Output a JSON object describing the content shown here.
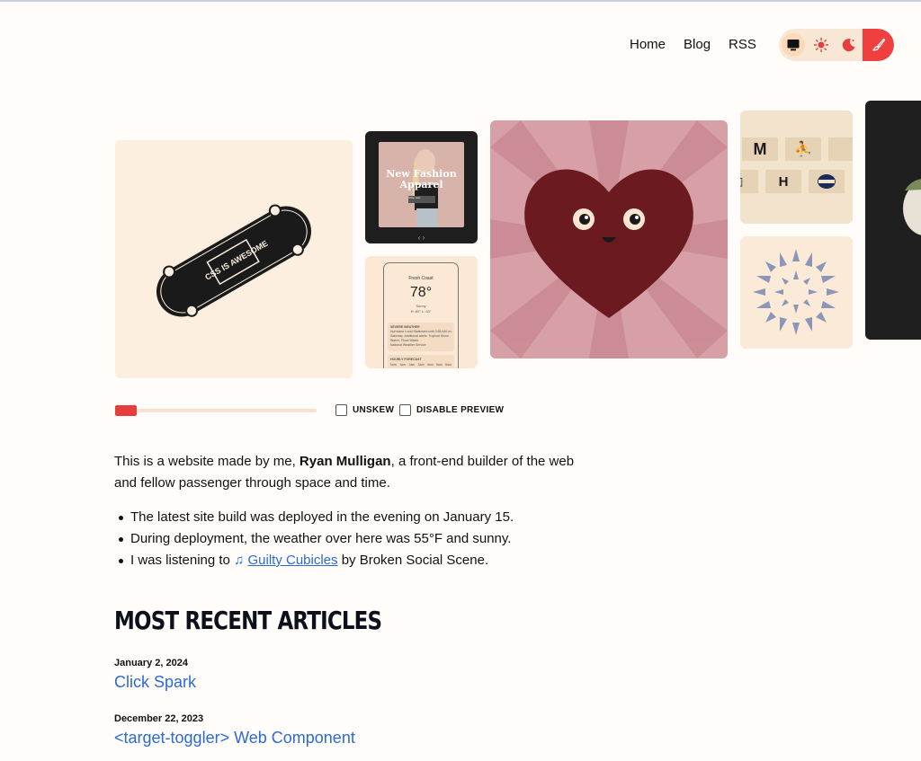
{
  "nav": {
    "home": "Home",
    "blog": "Blog",
    "rss": "RSS"
  },
  "theme_switcher": {
    "options": [
      "monitor-icon",
      "sun-icon",
      "moon-icon",
      "brush-icon"
    ],
    "active": "monitor-icon"
  },
  "gallery": {
    "skateboard_text": "CSS IS AWESOME",
    "fashion_title": "New Fashion Apparel",
    "fashion_button": "Shop now",
    "weather_city": "Fresh Coast",
    "weather_temp": "78°",
    "weather_cond": "Sunny",
    "weather_hilo": "H: 80° L: 63°",
    "weather_alert_title": "SEVERE WEATHER",
    "weather_alert_text": "Hurricane Local Statement until 3:55 AM on Saturday. Additional alerts: Tropical Storm Watch, Flood Watch.",
    "weather_source": "National Weather Service",
    "weather_forecast_title": "HOURLY FORECAST",
    "weather_forecast_days": [
      "Now",
      "1am",
      "2am",
      "3am",
      "4am",
      "5am",
      "6am"
    ]
  },
  "controls": {
    "slider_value": 0,
    "unskew_label": "UNSKEW",
    "disable_preview_label": "DISABLE PREVIEW"
  },
  "intro": {
    "before": "This is a website made by me, ",
    "name": "Ryan Mulligan",
    "after": ", a front-end builder of the web and fellow passenger through space and time."
  },
  "bullets": {
    "build": "The latest site build was deployed in the evening on January 15.",
    "weather": "During deployment, the weather over here was 55°F and sunny.",
    "listening_prefix": "I was listening to ",
    "music_glyph": "♫",
    "song": "Guilty Cubicles",
    "listening_suffix": " by Broken Social Scene."
  },
  "articles": {
    "heading": "MOST RECENT ARTICLES",
    "items": [
      {
        "date": "January 2, 2024",
        "title": "Click Spark"
      },
      {
        "date": "December 22, 2023",
        "title": "<target-toggler> Web Component"
      }
    ]
  },
  "colors": {
    "accent": "#e63d3d",
    "link": "#2b6bd6",
    "background": "#fffcfa",
    "tile_cream": "#fdefdf"
  }
}
